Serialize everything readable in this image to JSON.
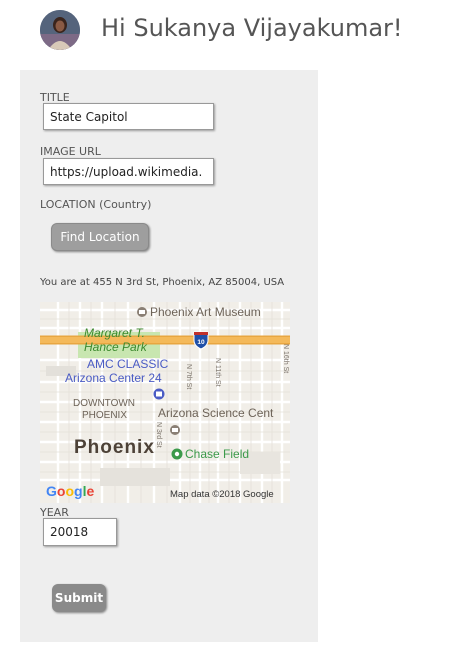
{
  "header": {
    "greeting": "Hi Sukanya Vijayakumar!"
  },
  "form": {
    "title_label": "TITLE",
    "title_value": "State Capitol",
    "image_url_label": "IMAGE URL",
    "image_url_value": "https://upload.wikimedia.",
    "location_label": "LOCATION (Country)",
    "find_location_button": "Find Location",
    "location_result": "You are at 455 N 3rd St, Phoenix, AZ 85004, USA",
    "year_label": "YEAR",
    "year_value": "20018",
    "submit_button": "Submit"
  },
  "map": {
    "labels": {
      "art_museum": "Phoenix Art Museum",
      "park_line1": "Margaret T.",
      "park_line2": "Hance Park",
      "cinema_line1": "AMC CLASSIC",
      "cinema_line2": "Arizona Center 24",
      "downtown_line1": "DOWNTOWN",
      "downtown_line2": "PHOENIX",
      "science_center": "Arizona Science Cent",
      "city": "Phoenix",
      "stadium": "Chase Field",
      "street_7th": "N 7th St",
      "street_11th": "N 11th St",
      "street_16th": "N 16th St",
      "street_3rd": "N 3rd St",
      "interstate": "10"
    },
    "logo": "Google",
    "attribution": "Map data ©2018 Google"
  },
  "colors": {
    "panel_bg": "#eeeeee",
    "button_bg": "#9e9e9e",
    "park_green": "#c8e6b0",
    "highway": "#f2b959",
    "poi_blue": "#4a5bc4"
  }
}
